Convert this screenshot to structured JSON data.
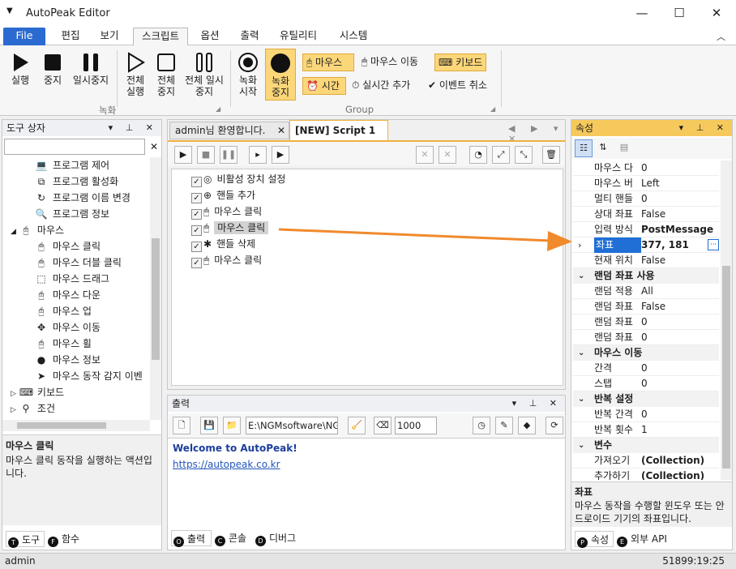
{
  "window": {
    "title": "AutoPeak Editor",
    "menu_icon": "caret-down-icon"
  },
  "menu_tabs": [
    "File",
    "편집",
    "보기",
    "스크립트",
    "옵션",
    "출력",
    "유틸리티",
    "시스템"
  ],
  "ribbon": {
    "run": "실행",
    "stop": "중지",
    "pause": "일시중지",
    "run_all": "전체 실행",
    "stop_all": "전체 중지",
    "pause_all": "전체 일시중지",
    "record_start": "녹화 시작",
    "record_stop": "녹화 중지",
    "group_record": "녹화",
    "group_group": "Group",
    "mouse": "마우스",
    "mouse_move": "마우스 이동",
    "keyboard": "키보드",
    "time": "시간",
    "realtime_add": "실시간 추가",
    "event_cancel": "이벤트 취소"
  },
  "toolbox": {
    "title": "도구 상자",
    "items": [
      {
        "label": "프로그램 제어",
        "icon": "laptop-icon"
      },
      {
        "label": "프로그램 활성화",
        "icon": "window-icon"
      },
      {
        "label": "프로그램 이름 변경",
        "icon": "rename-icon"
      },
      {
        "label": "프로그램 정보",
        "icon": "search-icon"
      },
      {
        "label": "마우스",
        "icon": "mouse-icon",
        "group": true
      },
      {
        "label": "마우스 클릭",
        "icon": "mouse-click-icon"
      },
      {
        "label": "마우스 더블 클릭",
        "icon": "mouse-double-icon"
      },
      {
        "label": "마우스 드래그",
        "icon": "drag-icon"
      },
      {
        "label": "마우스 다운",
        "icon": "mouse-down-icon"
      },
      {
        "label": "마우스 업",
        "icon": "mouse-up-icon"
      },
      {
        "label": "마우스 이동",
        "icon": "move-icon"
      },
      {
        "label": "마우스 휠",
        "icon": "wheel-icon"
      },
      {
        "label": "마우스 정보",
        "icon": "info-icon"
      },
      {
        "label": "마우스 동작 감지 이벤",
        "icon": "detect-icon"
      },
      {
        "label": "키보드",
        "icon": "keyboard-icon",
        "group": true
      },
      {
        "label": "조건",
        "icon": "condition-icon",
        "group": true
      }
    ],
    "desc_title": "마우스 클릭",
    "desc_text": "마우스 클릭 동작을 실행하는 액션입니다.",
    "tab_tools": "도구",
    "tab_funcs": "함수"
  },
  "editor": {
    "tab1": "admin님 환영합니다.",
    "tab2": "[NEW] Script 1",
    "steps": [
      "비활성 장치 설정",
      "핸들 추가",
      "마우스 클릭",
      "마우스 클릭",
      "핸들 삭제",
      "마우스 클릭"
    ]
  },
  "output": {
    "title": "출력",
    "path": "E:\\NGMsoftware\\NG",
    "interval": "1000",
    "welcome": "Welcome to AutoPeak!",
    "link": "https://autopeak.co.kr",
    "tab_output": "출력",
    "tab_console": "콘솔",
    "tab_debugger": "디버그"
  },
  "properties": {
    "title": "속성",
    "rows": [
      {
        "k": "마우스 다",
        "v": "0"
      },
      {
        "k": "마우스 버",
        "v": "Left"
      },
      {
        "k": "멀티 핸들",
        "v": "0"
      },
      {
        "k": "상대 좌표",
        "v": "False"
      },
      {
        "k": "입력 방식",
        "v": "PostMessage",
        "bold": true
      },
      {
        "k": "좌표",
        "v": "377, 181",
        "selected": true
      },
      {
        "k": "현재 위치",
        "v": "False"
      },
      {
        "cat": "랜덤 좌표 사용"
      },
      {
        "k": "랜덤 적용",
        "v": "All"
      },
      {
        "k": "랜덤 좌표",
        "v": "False"
      },
      {
        "k": "랜덤 좌표",
        "v": "0"
      },
      {
        "k": "랜덤 좌표",
        "v": "0"
      },
      {
        "cat": "마우스 이동"
      },
      {
        "k": "간격",
        "v": "0"
      },
      {
        "k": "스탭",
        "v": "0"
      },
      {
        "cat": "반복 설정"
      },
      {
        "k": "반복 간격",
        "v": "0"
      },
      {
        "k": "반복 횟수",
        "v": "1"
      },
      {
        "cat": "변수"
      },
      {
        "k": "가져오기",
        "v": "(Collection)",
        "bold": true
      },
      {
        "k": "추가하기",
        "v": "(Collection)",
        "bold": true
      }
    ],
    "desc_title": "좌표",
    "desc_text": "마우스 동작을 수행할 윈도우 또는 안드로이드 기기의 좌표입니다.",
    "tab_props": "속성",
    "tab_api": "외부 API"
  },
  "status": {
    "user": "admin",
    "time": "51899:19:25"
  },
  "colors": {
    "accent": "#2b6bd1",
    "highlight": "#fcd77a",
    "arrow": "#f08a2c"
  }
}
